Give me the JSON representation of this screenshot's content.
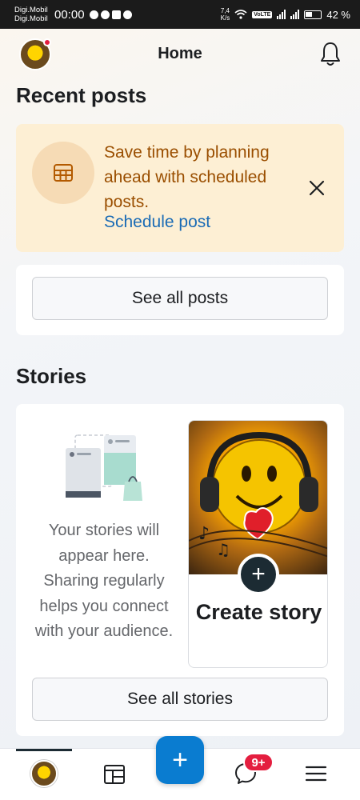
{
  "status_bar": {
    "carrier_1": "Digi.Mobil",
    "carrier_2": "Digi.Mobil",
    "time": "00:00",
    "net_speed_value": "7,4",
    "net_speed_unit": "K/s",
    "volte": "VoLTE",
    "battery": "42 %"
  },
  "header": {
    "title": "Home"
  },
  "recent_posts": {
    "title": "Recent posts",
    "banner_text": "Save time by planning ahead with scheduled posts.",
    "banner_link": "Schedule post",
    "see_all_label": "See all posts"
  },
  "stories": {
    "title": "Stories",
    "empty_text": "Your stories will appear here. Sharing regularly helps you connect with your audience.",
    "create_label": "Create story",
    "see_all_label": "See all stories"
  },
  "bottom_nav": {
    "fab_label": "+",
    "notifications_badge": "9+"
  },
  "colors": {
    "accent": "#0a7cd0",
    "banner_bg": "#fdefd4",
    "banner_text": "#9a4e00",
    "link": "#1a6bb5",
    "badge": "#e41e3f"
  }
}
